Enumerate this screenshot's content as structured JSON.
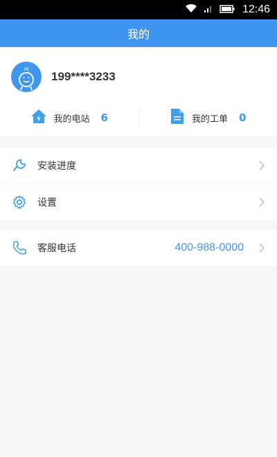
{
  "status_bar": {
    "time": "12:46"
  },
  "header": {
    "title": "我的"
  },
  "profile": {
    "avatar_text": "Hi",
    "phone": "199****3233"
  },
  "stats": [
    {
      "label": "我的电站",
      "count": "6",
      "icon": "house-icon"
    },
    {
      "label": "我的工单",
      "count": "0",
      "icon": "document-icon"
    }
  ],
  "menu": {
    "install_progress": "安装进度",
    "settings": "设置",
    "customer_service": "客服电话",
    "customer_service_number": "400-988-0000"
  },
  "colors": {
    "accent": "#3f95ef",
    "status_bar": "#000000",
    "background": "#f7f7f7"
  }
}
